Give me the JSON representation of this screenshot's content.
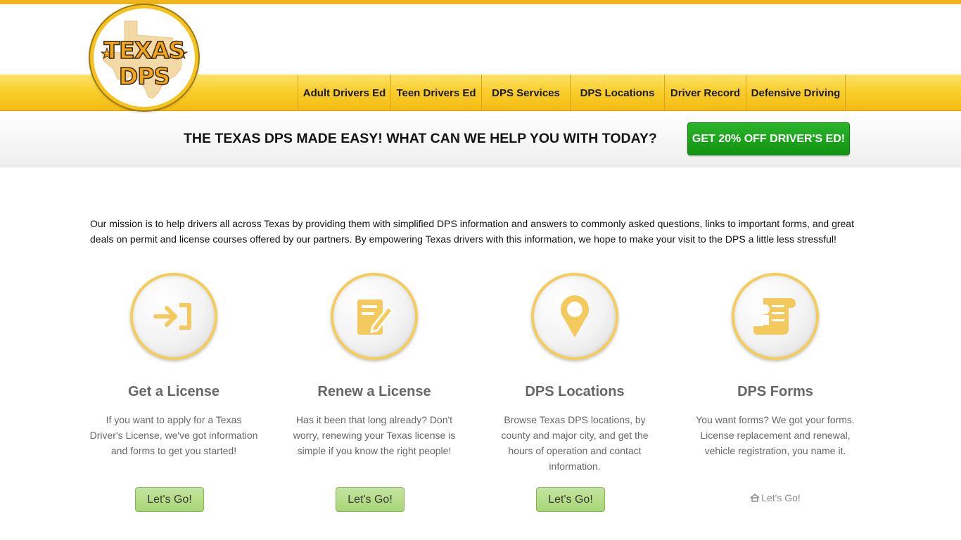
{
  "logo": {
    "line1": "TEXAS",
    "line2": "DPS",
    "star": "★"
  },
  "nav": {
    "items": [
      {
        "label": "Adult Drivers Ed",
        "width": 132
      },
      {
        "label": "Teen Drivers Ed",
        "width": 129
      },
      {
        "label": "DPS Services",
        "width": 126
      },
      {
        "label": "DPS Locations",
        "width": 134
      },
      {
        "label": "Driver Record",
        "width": 116
      },
      {
        "label": "Defensive Driving",
        "width": 142
      }
    ]
  },
  "banner": {
    "title": "THE TEXAS DPS MADE EASY! WHAT CAN WE HELP YOU WITH TODAY?",
    "cta_label": "GET 20% OFF DRIVER'S ED!"
  },
  "mission": "Our mission is to help drivers all across Texas by providing them with simplified DPS information and answers to commonly asked questions, links to important forms, and great deals on permit and license courses offered by our partners.  By empowering Texas drivers with this information, we hope to make your visit to the DPS a little less stressful!",
  "cards": [
    {
      "title": "Get a License",
      "desc": "If you want to apply for a Texas Driver's License, we've got information and forms to get you started!",
      "button": "Let's Go!",
      "icon": "sign-in-icon"
    },
    {
      "title": "Renew a License",
      "desc": "Has it been that long already?  Don't worry, renewing your Texas license is simple if you know the right people!",
      "button": "Let's Go!",
      "icon": "edit-document-icon"
    },
    {
      "title": "DPS Locations",
      "desc": "Browse Texas DPS locations, by county and major city, and get the hours of operation and contact information.",
      "button": "Let's Go!",
      "icon": "map-pin-icon"
    },
    {
      "title": "DPS Forms",
      "desc": "You want forms?  We got your forms.  License replacement and renewal, vehicle registration, you name it.",
      "button": "Let's Go!",
      "icon": "scroll-document-icon"
    }
  ],
  "colors": {
    "accent": "#f4bb13",
    "cta_green": "#129312",
    "button_green": "#a8d676",
    "icon_gold": "#f4c95d"
  }
}
